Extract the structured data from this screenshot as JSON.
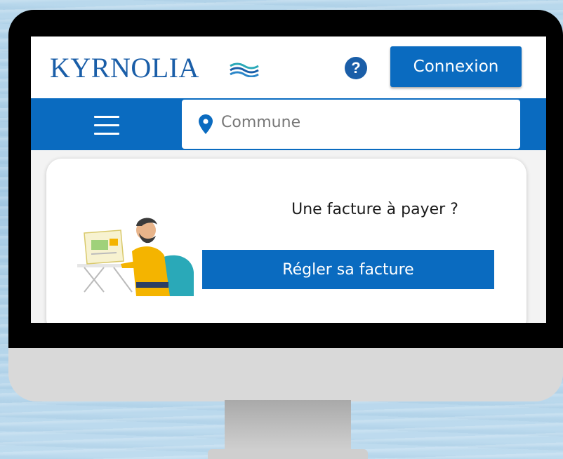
{
  "header": {
    "logo_text": "KYRNOLIA",
    "help_icon": "question-circle-icon",
    "help_glyph": "?",
    "login_label": "Connexion"
  },
  "navbar": {
    "menu_icon": "hamburger-menu-icon",
    "search": {
      "icon": "location-pin-icon",
      "placeholder": "Commune"
    }
  },
  "card": {
    "title": "Une facture à payer ?",
    "button_label": "Régler sa facture",
    "illustration": "person-at-laptop-illustration"
  },
  "colors": {
    "brand_blue": "#0a6bc0",
    "logo_blue": "#1a5ea8",
    "illustration_yellow": "#f4b400",
    "illustration_teal": "#2aa9b8"
  }
}
